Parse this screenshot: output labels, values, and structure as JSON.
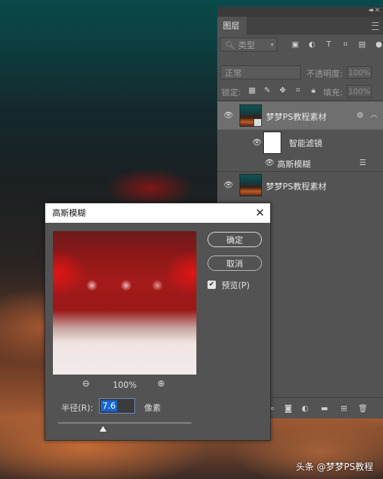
{
  "layers_panel": {
    "tab_label": "图层",
    "filter": {
      "kind_label": "类型"
    },
    "blend_mode": "正常",
    "opacity_label": "不透明度:",
    "opacity_value": "100%",
    "lock_label": "锁定:",
    "fill_label": "填充:",
    "fill_value": "100%",
    "layers": [
      {
        "name": "梦梦PS教程素材",
        "selected": true,
        "smart_object": true
      },
      {
        "name": "智能滤镜",
        "type": "smart-filter-mask"
      },
      {
        "name": "高斯模糊",
        "type": "filter-entry"
      },
      {
        "name": "梦梦PS教程素材",
        "selected": false
      }
    ]
  },
  "dialog": {
    "title": "高斯模糊",
    "ok_label": "确定",
    "cancel_label": "取消",
    "preview_label": "预览(P)",
    "preview_checked": true,
    "zoom_value": "100%",
    "radius_label": "半径(R):",
    "radius_value": "7.6",
    "radius_unit": "像素",
    "slider_level": 0.34
  },
  "watermark": "头条 @梦梦PS教程"
}
